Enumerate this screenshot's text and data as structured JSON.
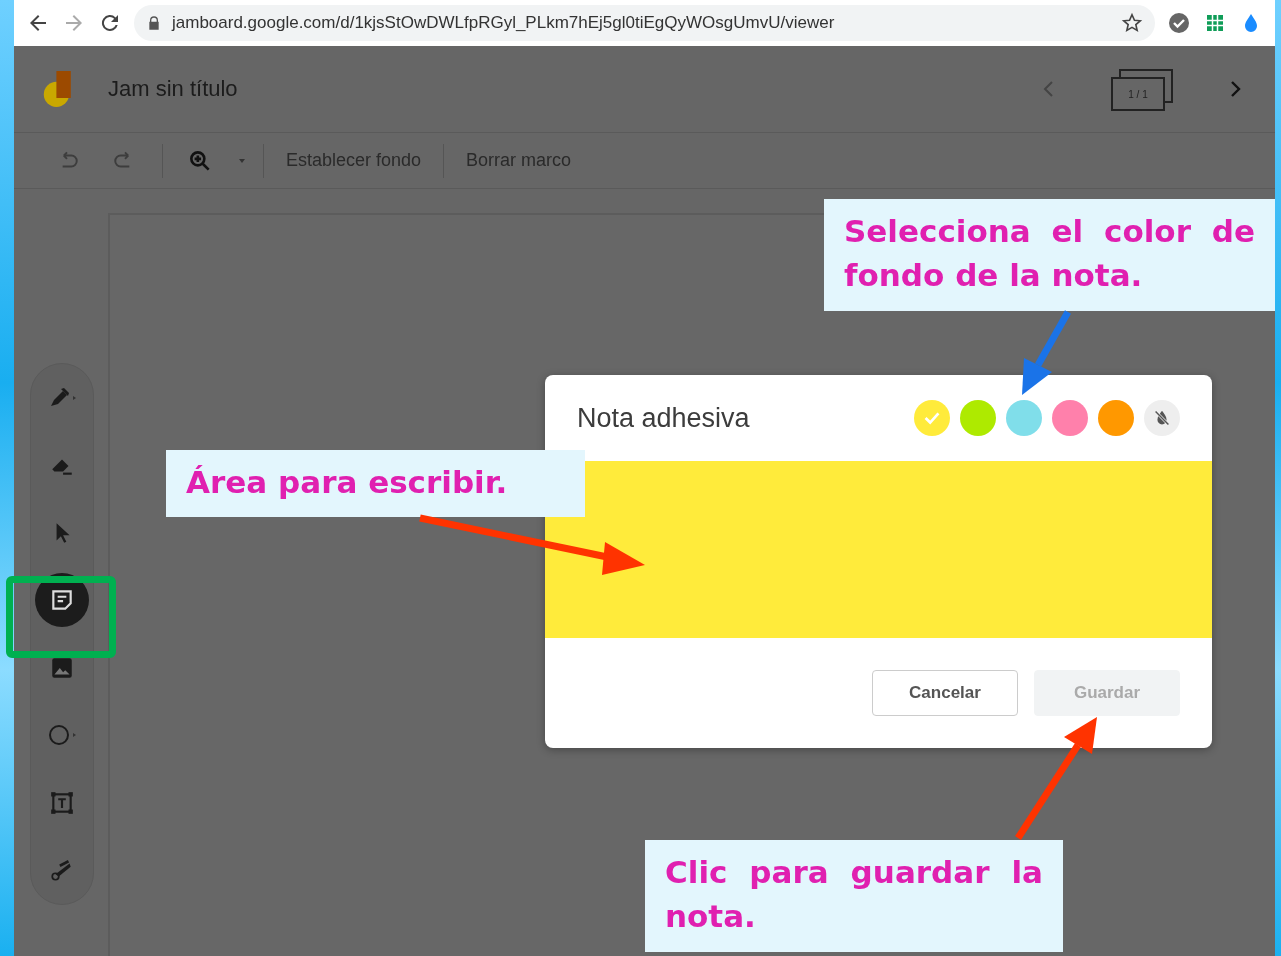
{
  "browser": {
    "url": "jamboard.google.com/d/1kjsStOwDWLfpRGyl_PLkm7hEj5gl0tiEgQyWOsgUmvU/viewer"
  },
  "app": {
    "title": "Jam sin título",
    "frame_counter": "1 / 1"
  },
  "toolbar": {
    "items": [
      "Establecer fondo",
      "Borrar marco"
    ]
  },
  "tools": [
    {
      "kind": "pen",
      "selected": false
    },
    {
      "kind": "eraser",
      "selected": false
    },
    {
      "kind": "select",
      "selected": false
    },
    {
      "kind": "note",
      "selected": true
    },
    {
      "kind": "image",
      "selected": false
    },
    {
      "kind": "circle",
      "selected": false
    },
    {
      "kind": "textbox",
      "selected": false
    },
    {
      "kind": "laser",
      "selected": false
    }
  ],
  "dialog": {
    "title": "Nota adhesiva",
    "colors": [
      {
        "color": "#ffeb3b",
        "selected": true
      },
      {
        "color": "#aeea00",
        "selected": false
      },
      {
        "color": "#80deea",
        "selected": false
      },
      {
        "color": "#ff80ab",
        "selected": false
      },
      {
        "color": "#ff9800",
        "selected": false
      }
    ],
    "buttons": [
      {
        "label": "Cancelar",
        "disabled": false
      },
      {
        "label": "Guardar",
        "disabled": true
      }
    ]
  },
  "annotations": [
    {
      "text": "Selecciona el color de fondo de la nota."
    },
    {
      "text": "Área para escribir."
    },
    {
      "text": "Clic para guardar la nota."
    }
  ]
}
